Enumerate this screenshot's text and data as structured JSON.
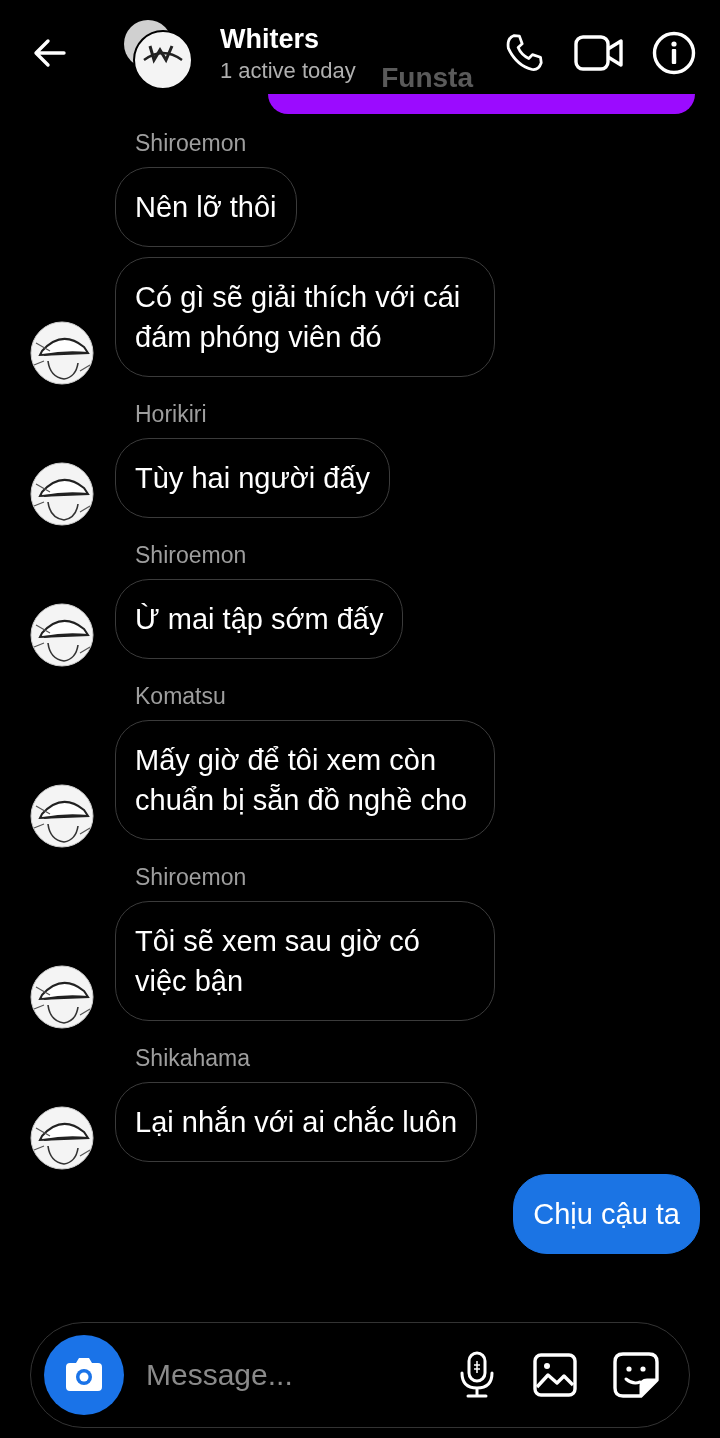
{
  "header": {
    "title": "Whiters",
    "status": "1 active today"
  },
  "scrolled_message": {
    "text": "Funsta",
    "color": "#9b0bff"
  },
  "messages": [
    {
      "kind": "incoming",
      "sender": "Shiroemon",
      "text": "Nên lỡ thôi",
      "avatar": false
    },
    {
      "kind": "incoming",
      "text": "Có gì sẽ giải thích với cái đám phóng viên đó",
      "avatar": true
    },
    {
      "kind": "incoming",
      "sender": "Horikiri",
      "text": "Tùy hai người đấy",
      "avatar": true
    },
    {
      "kind": "incoming",
      "sender": "Shiroemon",
      "text": "Ừ mai tập sớm đấy",
      "avatar": true
    },
    {
      "kind": "incoming",
      "sender": "Komatsu",
      "text": "Mấy giờ để tôi xem còn chuẩn bị sẵn đồ nghề cho",
      "avatar": true
    },
    {
      "kind": "incoming",
      "sender": "Shiroemon",
      "text": "Tôi sẽ xem sau giờ có việc bận",
      "avatar": true
    },
    {
      "kind": "incoming",
      "sender": "Shikahama",
      "text": "Lại nhắn với ai chắc luôn",
      "avatar": true
    },
    {
      "kind": "outgoing",
      "text": "Chịu cậu ta"
    }
  ],
  "composer": {
    "placeholder": "Message..."
  }
}
